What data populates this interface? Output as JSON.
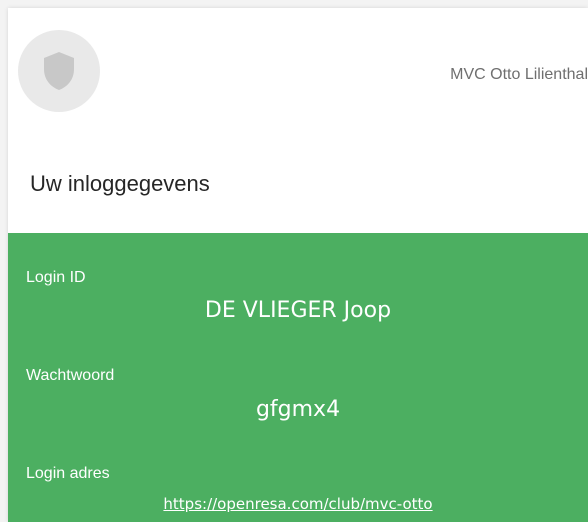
{
  "header": {
    "logo_icon": "shield-icon",
    "club_name": "MVC Otto Lilienthal"
  },
  "section": {
    "title": "Uw inloggegevens"
  },
  "credentials": {
    "background_color": "#4caf61",
    "login_id_label": "Login ID",
    "login_id_value": "DE VLIEGER Joop",
    "password_label": "Wachtwoord",
    "password_value": "gfgmx4",
    "login_address_label": "Login adres",
    "login_address_value": "https://openresa.com/club/mvc-otto"
  }
}
